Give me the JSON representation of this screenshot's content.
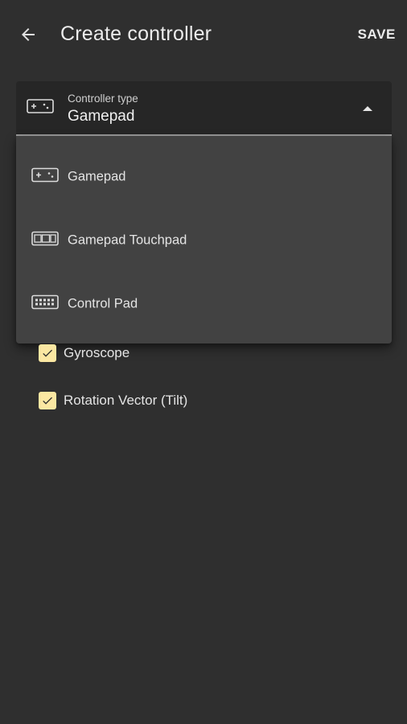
{
  "appbar": {
    "title": "Create controller",
    "back_icon": "arrow-back-icon",
    "save_label": "SAVE"
  },
  "select": {
    "label": "Controller type",
    "value": "Gamepad",
    "icon": "gamepad-icon",
    "arrow_icon": "arrow-up-icon"
  },
  "menu": {
    "items": [
      {
        "label": "Gamepad",
        "icon": "gamepad-icon"
      },
      {
        "label": "Gamepad Touchpad",
        "icon": "gamepad-touchpad-icon"
      },
      {
        "label": "Control Pad",
        "icon": "control-pad-icon"
      }
    ]
  },
  "sensors": [
    {
      "label": "Gyroscope",
      "checked": true
    },
    {
      "label": "Rotation Vector (Tilt)",
      "checked": true
    }
  ],
  "colors": {
    "background": "#2f2f2f",
    "field": "#262626",
    "menu": "#424242",
    "checkbox": "#fbe7a2"
  }
}
